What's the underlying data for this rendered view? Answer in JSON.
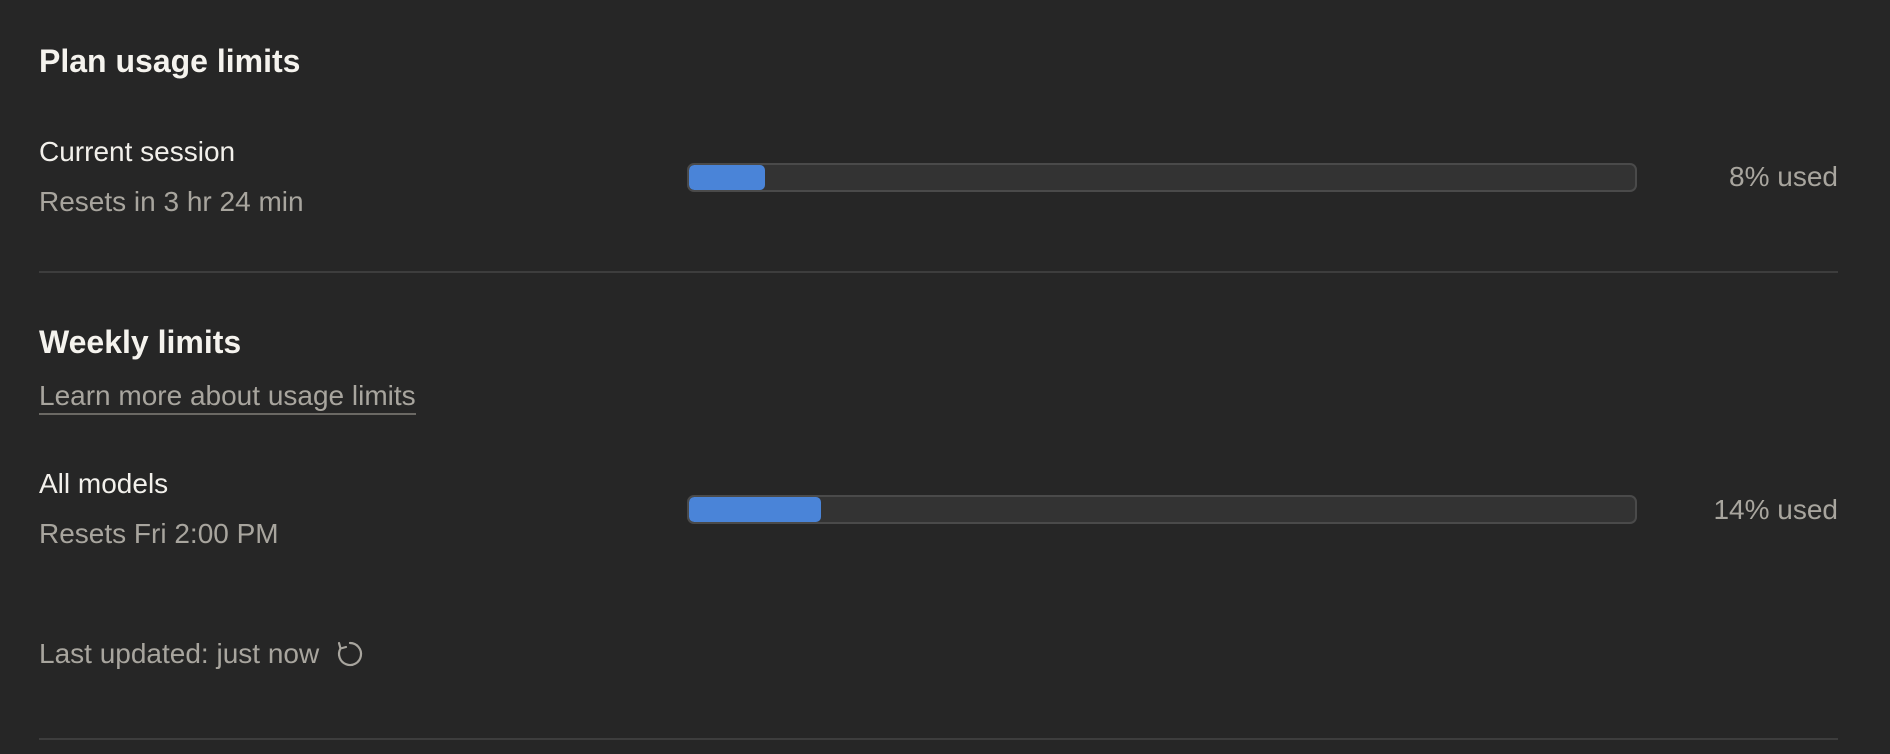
{
  "plan": {
    "title": "Plan usage limits",
    "session": {
      "label": "Current session",
      "reset": "Resets in 3 hr 24 min",
      "percent": 8,
      "percent_text": "8% used"
    }
  },
  "weekly": {
    "title": "Weekly limits",
    "learn_more": "Learn more about usage limits",
    "all_models": {
      "label": "All models",
      "reset": "Resets Fri 2:00 PM",
      "percent": 14,
      "percent_text": "14% used"
    }
  },
  "footer": {
    "last_updated": "Last updated: just now",
    "refresh_icon": "refresh-icon"
  },
  "colors": {
    "background": "#262626",
    "bar_fill": "#4a84d8",
    "bar_track": "#333333"
  }
}
